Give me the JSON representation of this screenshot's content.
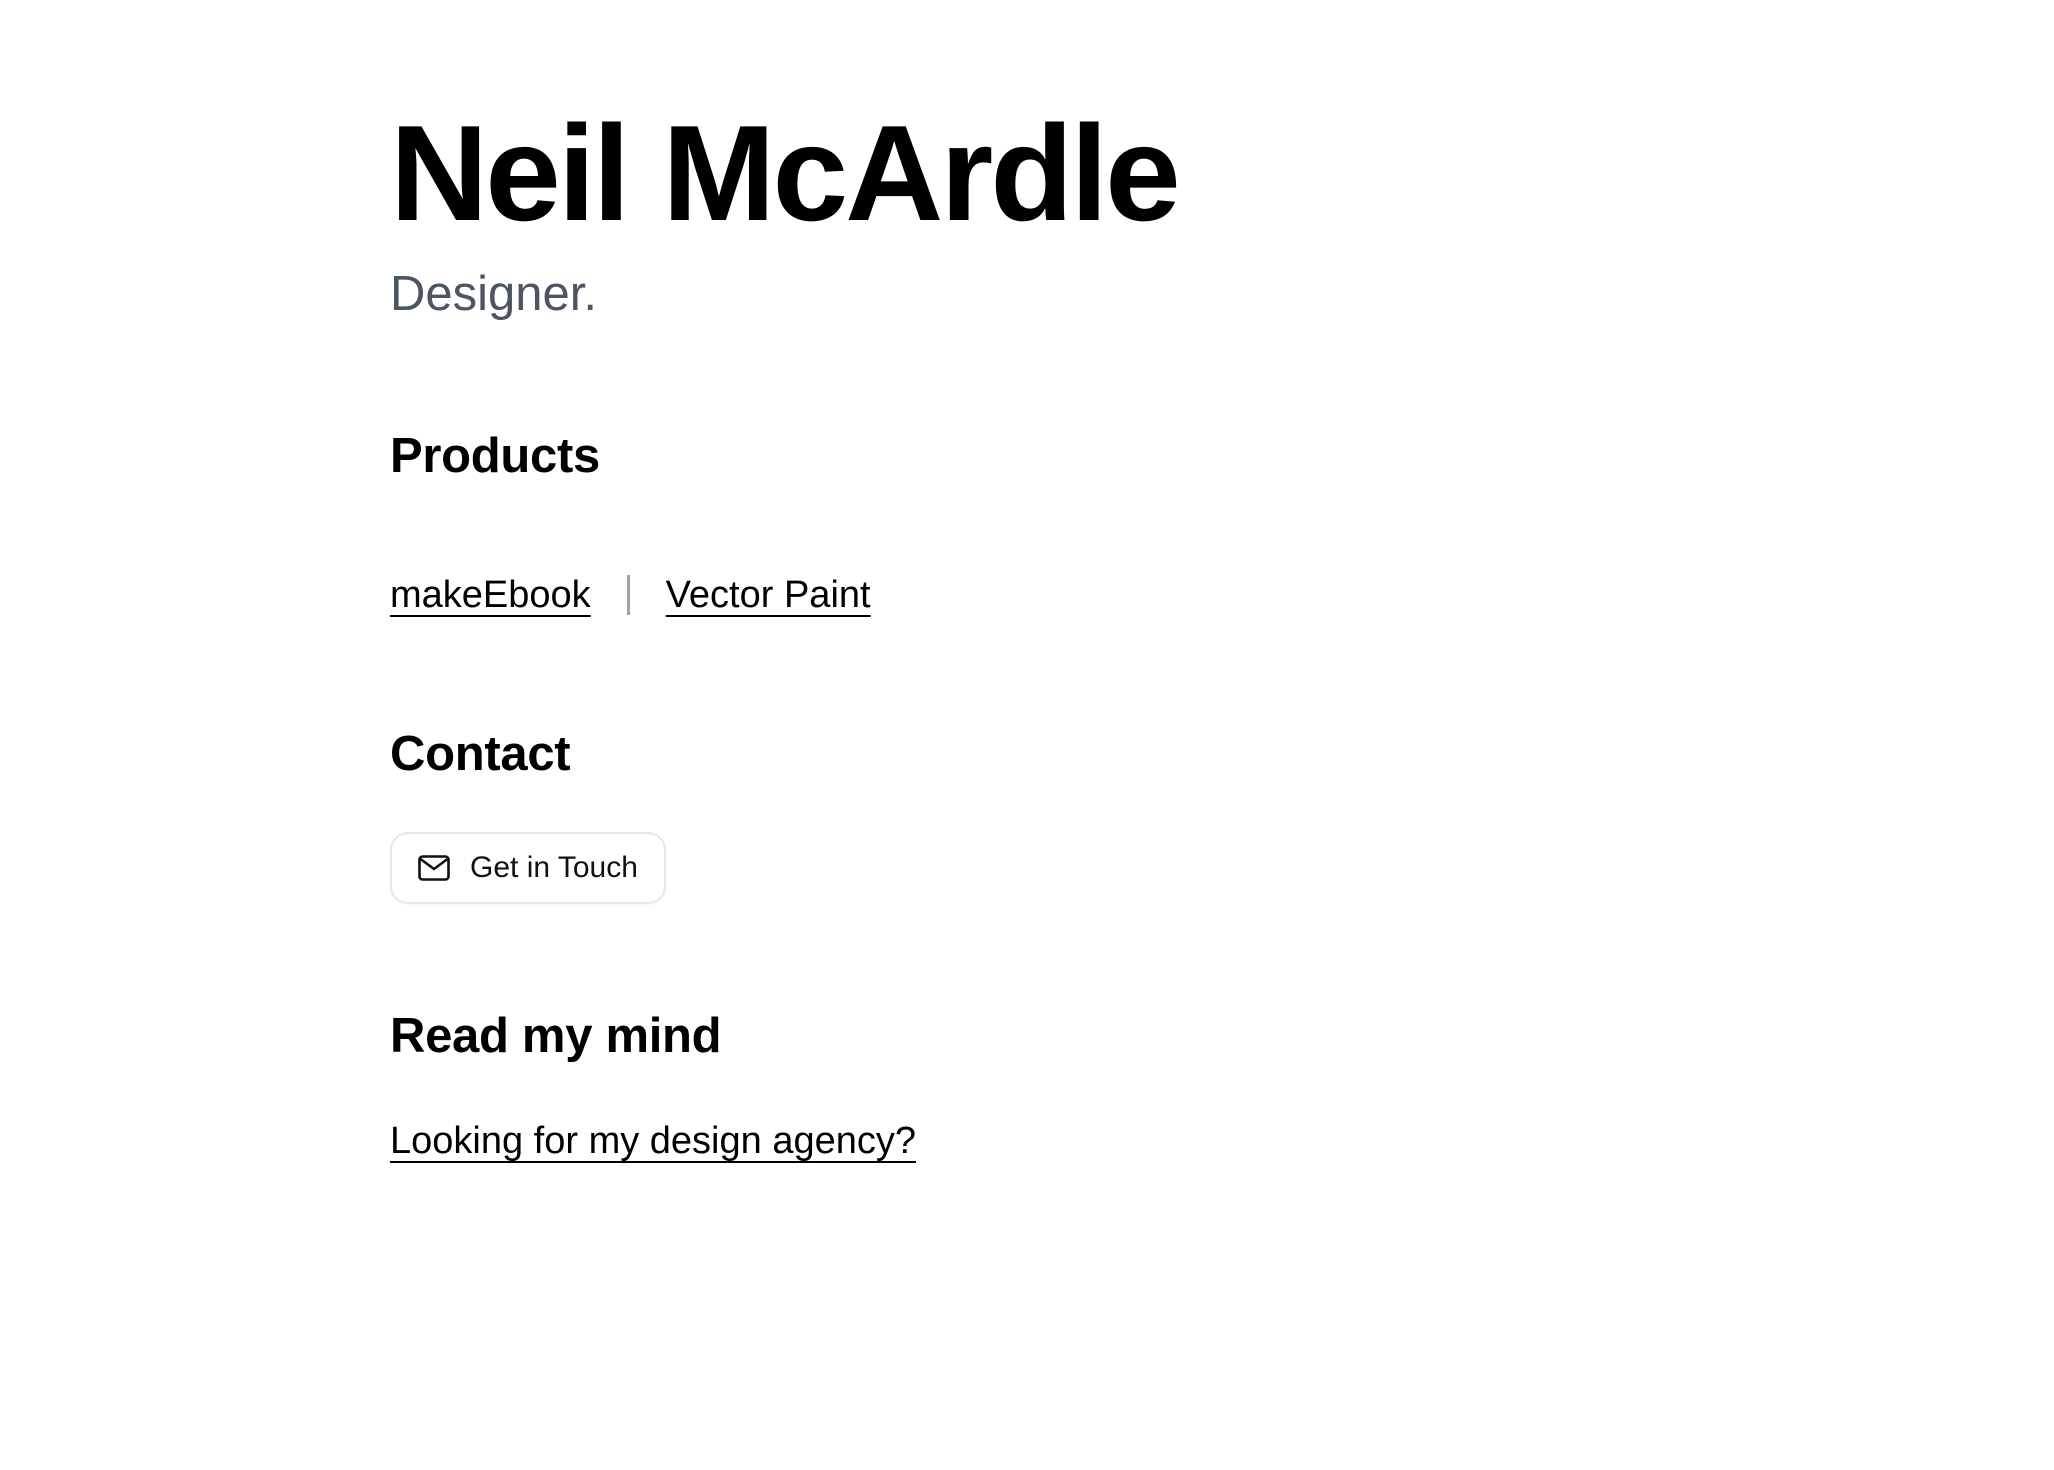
{
  "header": {
    "name": "Neil McArdle",
    "role": "Designer."
  },
  "products": {
    "heading": "Products",
    "items": [
      {
        "label": "makeEbook"
      },
      {
        "label": "Vector Paint"
      }
    ]
  },
  "contact": {
    "heading": "Contact",
    "button_label": "Get in Touch",
    "button_icon": "mail-icon"
  },
  "mind": {
    "heading": "Read my mind",
    "link_label": "Looking for my design agency?"
  },
  "colors": {
    "text": "#000000",
    "muted": "#4b5563",
    "divider": "#9ca3af",
    "button_border": "#e5e7eb"
  }
}
